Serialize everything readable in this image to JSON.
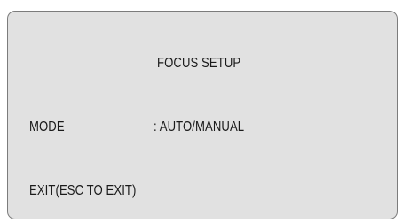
{
  "menu": {
    "title": "FOCUS SETUP",
    "items": [
      {
        "label": "MODE",
        "value": ": AUTO/MANUAL"
      }
    ],
    "exit_label": "EXIT(ESC TO EXIT)"
  },
  "colors": {
    "panel_background": "#e1e1e1",
    "panel_border": "#7c7c7c",
    "text": "#1a1a1a"
  }
}
